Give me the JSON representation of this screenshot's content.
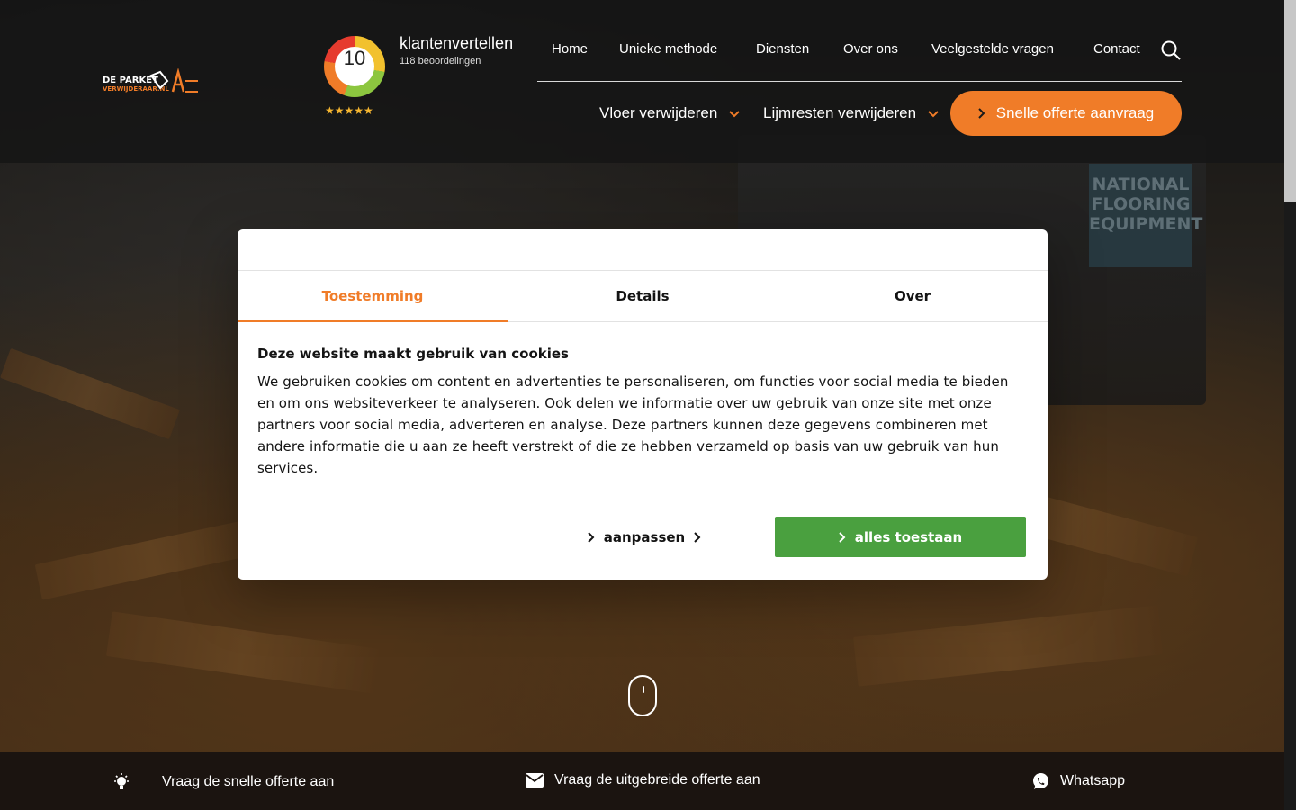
{
  "brand": {
    "logo_line1": "DE PARKET",
    "logo_line2": "VERWIJDERAAR.NL",
    "accent": "#f07c28",
    "allow_green": "#4aa03f"
  },
  "rating": {
    "score": "10",
    "brand": "klantenvertellen",
    "count": "118 beoordelingen",
    "stars": "★★★★★"
  },
  "topnav": {
    "items": [
      "Home",
      "Unieke methode",
      "Diensten",
      "Over ons",
      "Veelgestelde vragen",
      "Contact"
    ]
  },
  "subnav": {
    "items": [
      "Vloer verwijderen",
      "Lijmresten verwijderen"
    ],
    "cta": "Snelle offerte aanvraag"
  },
  "background": {
    "machine_label": "NATIONAL FLOORING EQUIPMENT"
  },
  "cookie": {
    "tabs": [
      "Toestemming",
      "Details",
      "Over"
    ],
    "active_tab": "Toestemming",
    "title": "Deze website maakt gebruik van cookies",
    "text": "We gebruiken cookies om content en advertenties te personaliseren, om functies voor social media te bieden en om ons websiteverkeer te analyseren. Ook delen we informatie over uw gebruik van onze site met onze partners voor social media, adverteren en analyse. Deze partners kunnen deze gegevens combineren met andere informatie die u aan ze heeft verstrekt of die ze hebben verzameld op basis van uw gebruik van hun services.",
    "customize_label": "aanpassen",
    "allow_label": "alles toestaan"
  },
  "bottombar": {
    "items": [
      "Vraag de snelle offerte aan",
      "Vraag de uitgebreide offerte aan",
      "Whatsapp"
    ],
    "icons": [
      "lightbulb-icon",
      "mail-icon",
      "whatsapp-icon"
    ]
  }
}
